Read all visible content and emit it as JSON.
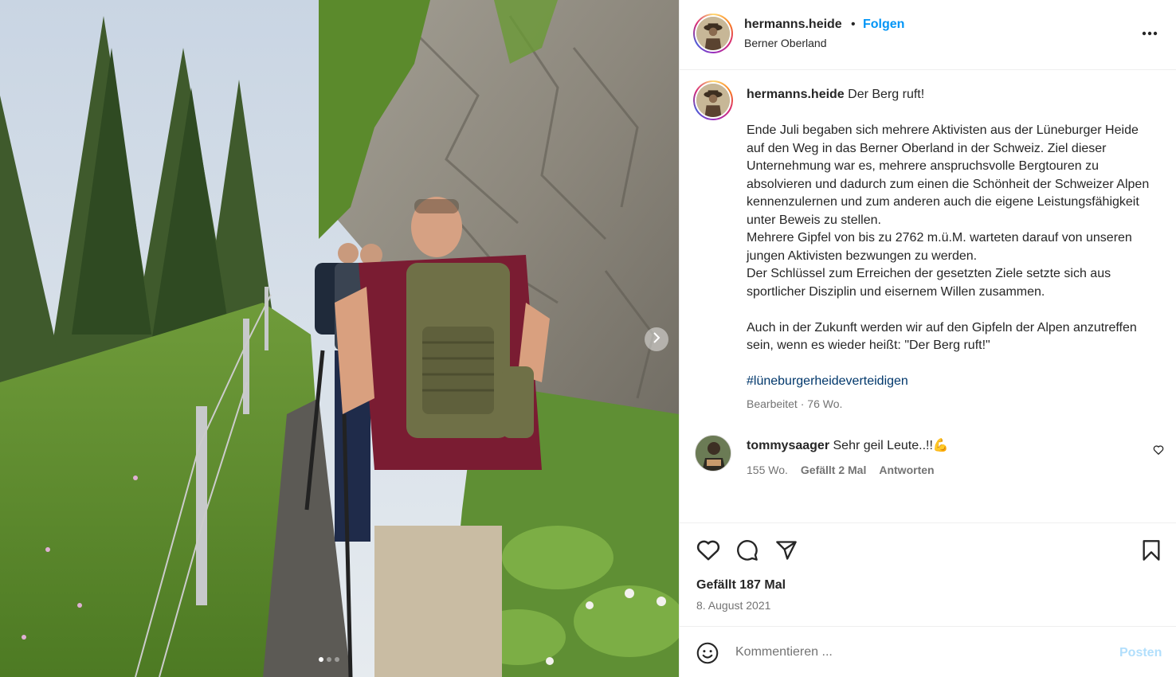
{
  "post": {
    "author": {
      "username": "hermanns.heide",
      "separator": "•",
      "follow_label": "Folgen",
      "location": "Berner Oberland",
      "more_icon": "more-horizontal-icon"
    },
    "caption": {
      "username": "hermanns.heide",
      "title": "Der Berg ruft!",
      "paragraphs": [
        "Ende Juli begaben sich mehrere Aktivisten aus der Lüneburger Heide auf den Weg in das Berner Oberland in der Schweiz. Ziel dieser Unternehmung war es, mehrere anspruchsvolle Bergtouren zu absolvieren und dadurch zum einen die Schönheit der Schweizer Alpen kennenzulernen und zum anderen auch die eigene Leistungsfähigkeit unter Beweis zu stellen.",
        "Mehrere Gipfel von bis zu 2762 m.ü.M. warteten darauf von unseren jungen Aktivisten bezwungen zu werden.",
        "Der Schlüssel zum Erreichen der gesetzten Ziele setzte sich aus sportlicher Disziplin und eisernem Willen zusammen.",
        "Auch in der Zukunft werden wir auf den Gipfeln der Alpen anzutreffen sein, wenn es wieder heißt: \"Der Berg ruft!\""
      ],
      "hashtag": "#lüneburgerheideverteidigen",
      "edited": "Bearbeitet",
      "dot": "·",
      "age": "76 Wo."
    },
    "comments": [
      {
        "username": "tommysaager",
        "text": "Sehr geil Leute..!!💪",
        "age": "155 Wo.",
        "likes": "Gefällt 2 Mal",
        "reply_label": "Antworten"
      }
    ],
    "likes_label": "Gefällt 187 Mal",
    "date": "8. August 2021",
    "composer": {
      "placeholder": "Kommentieren ...",
      "post_label": "Posten"
    },
    "carousel": {
      "slide_count": 3,
      "active_index": 0
    },
    "colors": {
      "link": "#0095f6",
      "hashtag": "#00376b",
      "muted": "#737373",
      "post_disabled": "#b2dffc"
    }
  }
}
